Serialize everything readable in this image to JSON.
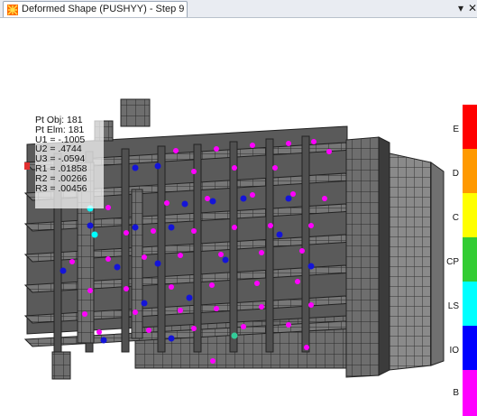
{
  "window": {
    "tab_title": "Deformed Shape (PUSHYY) - Step 9",
    "dropdown_glyph": "▾",
    "close_glyph": "✕"
  },
  "info_box": {
    "lines": [
      "Pt Obj: 181",
      "Pt Elm: 181",
      "U1 = -.1005",
      "U2 = .4744",
      "U3 = -.0594",
      "R1 = .01858",
      "R2 = .00266",
      "R3 = .00456"
    ]
  },
  "legend": {
    "labels": [
      "E",
      "D",
      "C",
      "CP",
      "LS",
      "IO",
      "B"
    ],
    "colors": [
      "#ff0000",
      "#ff9900",
      "#ffff00",
      "#33cc33",
      "#00ffff",
      "#0000ff",
      "#ff00ff"
    ]
  },
  "hinge_colors": {
    "B": "#ff00ff",
    "IO": "#0000ff",
    "LS": "#00ffff",
    "other": "#33cc99"
  },
  "icons": {
    "tab_icon": "structure-model-icon"
  }
}
